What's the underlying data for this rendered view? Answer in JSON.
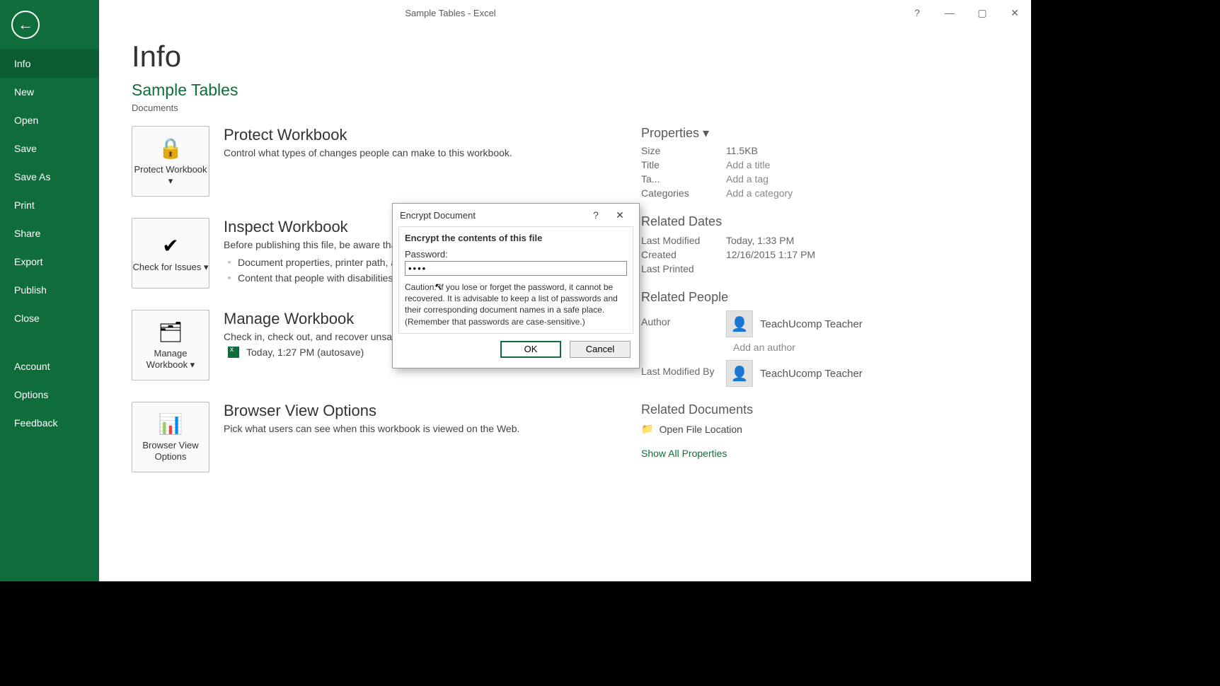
{
  "titlebar": {
    "title": "Sample Tables - Excel"
  },
  "account": {
    "name": "TeachUcomp Teacher"
  },
  "sidebar": {
    "items": [
      "Info",
      "New",
      "Open",
      "Save",
      "Save As",
      "Print",
      "Share",
      "Export",
      "Publish",
      "Close"
    ],
    "bottom": [
      "Account",
      "Options",
      "Feedback"
    ],
    "selected": 0
  },
  "page": {
    "title": "Info",
    "doc_title": "Sample Tables",
    "doc_path": "Documents"
  },
  "sections": {
    "protect": {
      "btn": "Protect Workbook ▾",
      "heading": "Protect Workbook",
      "desc": "Control what types of changes people can make to this workbook."
    },
    "inspect": {
      "btn": "Check for Issues ▾",
      "heading": "Inspect Workbook",
      "desc": "Before publishing this file, be aware that it contains:",
      "bullets": [
        "Document properties, printer path, author's name and absolute path",
        "Content that people with disabilities are unable to read"
      ]
    },
    "manage": {
      "btn": "Manage Workbook ▾",
      "heading": "Manage Workbook",
      "desc": "Check in, check out, and recover unsaved changes.",
      "autosave": "Today, 1:27 PM (autosave)"
    },
    "browser": {
      "btn": "Browser View Options",
      "heading": "Browser View Options",
      "desc": "Pick what users can see when this workbook is viewed on the Web."
    }
  },
  "properties": {
    "heading": "Properties ▾",
    "rows": [
      {
        "key": "Size",
        "val": "11.5KB"
      },
      {
        "key": "Title",
        "val": "Add a title",
        "add": true
      },
      {
        "key": "Ta...",
        "val": "Add a tag",
        "add": true
      },
      {
        "key": "Categories",
        "val": "Add a category",
        "add": true
      }
    ]
  },
  "related_dates": {
    "heading": "Related Dates",
    "rows": [
      {
        "key": "Last Modified",
        "val": "Today, 1:33 PM"
      },
      {
        "key": "Created",
        "val": "12/16/2015 1:17 PM"
      },
      {
        "key": "Last Printed",
        "val": ""
      }
    ]
  },
  "related_people": {
    "heading": "Related People",
    "author_key": "Author",
    "author_name": "TeachUcomp Teacher",
    "add_author": "Add an author",
    "mod_key": "Last Modified By",
    "mod_name": "TeachUcomp Teacher"
  },
  "related_documents": {
    "heading": "Related Documents",
    "open_loc": "Open File Location",
    "show_all": "Show All Properties"
  },
  "modal": {
    "title": "Encrypt Document",
    "subtitle": "Encrypt the contents of this file",
    "pw_label": "Password:",
    "pw_value": "••••",
    "caution": "Caution: If you lose or forget the password, it cannot be recovered. It is advisable to keep a list of passwords and their corresponding document names in a safe place.\n(Remember that passwords are case-sensitive.)",
    "ok": "OK",
    "cancel": "Cancel"
  }
}
